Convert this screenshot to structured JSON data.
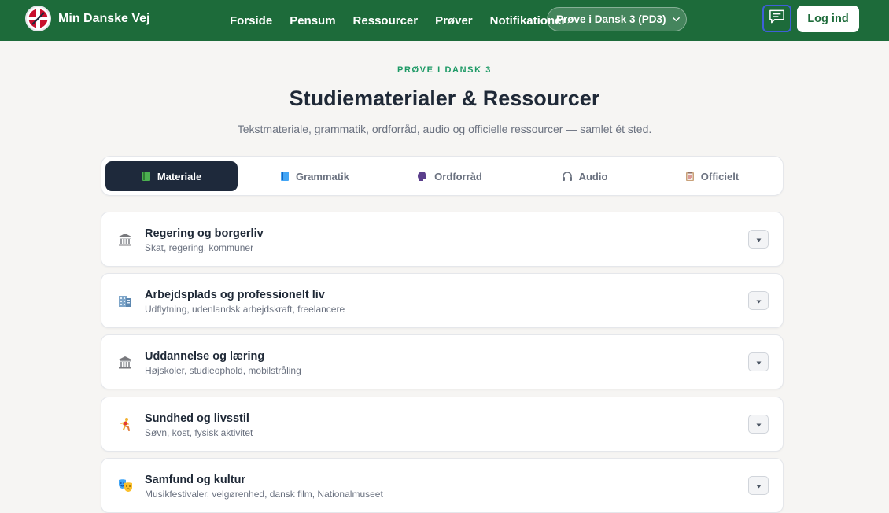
{
  "nav": {
    "brand": "Min Danske Vej",
    "links": [
      "Forside",
      "Pensum",
      "Ressourcer",
      "Prøver",
      "Notifikationer"
    ],
    "exam_select": "Prøve i Dansk 3 (PD3)",
    "login": "Log ind"
  },
  "header": {
    "eyebrow": "PRØVE I DANSK 3",
    "title": "Studiematerialer & Ressourcer",
    "subtitle": "Tekstmateriale, grammatik, ordforråd, audio og officielle ressourcer — samlet ét sted."
  },
  "tabs": [
    {
      "label": "Materiale",
      "icon": "green-book-icon",
      "active": true
    },
    {
      "label": "Grammatik",
      "icon": "blue-book-icon",
      "active": false
    },
    {
      "label": "Ordforråd",
      "icon": "speaking-head-icon",
      "active": false
    },
    {
      "label": "Audio",
      "icon": "headphones-icon",
      "active": false
    },
    {
      "label": "Officielt",
      "icon": "clipboard-icon",
      "active": false
    }
  ],
  "topics": [
    {
      "title": "Regering og borgerliv",
      "subtitle": "Skat, regering, kommuner",
      "icon": "classical-building-icon"
    },
    {
      "title": "Arbejdsplads og professionelt liv",
      "subtitle": "Udflytning, udenlandsk arbejdskraft, freelancere",
      "icon": "office-building-icon"
    },
    {
      "title": "Uddannelse og læring",
      "subtitle": "Højskoler, studieophold, mobilstråling",
      "icon": "classical-building-icon"
    },
    {
      "title": "Sundhed og livsstil",
      "subtitle": "Søvn, kost, fysisk aktivitet",
      "icon": "running-person-icon"
    },
    {
      "title": "Samfund og kultur",
      "subtitle": "Musikfestivaler, velgørenhed, dansk film, Nationalmuseet",
      "icon": "theater-masks-icon"
    }
  ],
  "colors": {
    "nav_bg": "#1d6b3a",
    "accent_green": "#1e9a66",
    "active_tab_bg": "#1e293b",
    "page_bg": "#f6f5f3"
  }
}
